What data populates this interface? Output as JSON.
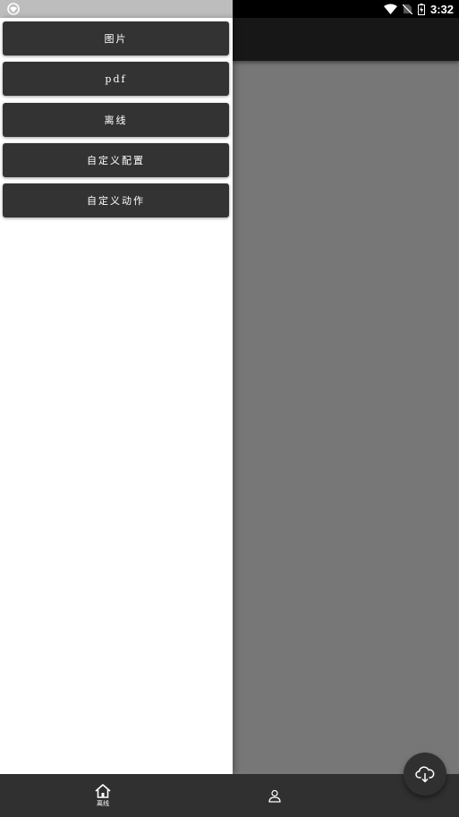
{
  "status_bar": {
    "time": "3:32",
    "icons": [
      "app-notification-icon",
      "wifi-icon",
      "no-sim-icon",
      "battery-charging-icon"
    ]
  },
  "drawer": {
    "items": [
      {
        "label": "图片"
      },
      {
        "label": "pdf"
      },
      {
        "label": "离线"
      },
      {
        "label": "自定义配置"
      },
      {
        "label": "自定义动作"
      }
    ]
  },
  "bottom_nav": {
    "items": [
      {
        "label": "离线",
        "icon": "home-icon"
      },
      {
        "label": "",
        "icon": "person-icon"
      }
    ]
  },
  "fab": {
    "icon": "cloud-download-icon"
  },
  "colors": {
    "drawer_bg": "#ffffff",
    "button_bg": "#333333",
    "scrim": "#777777",
    "toolbar": "#171717",
    "bottom_nav": "#303030"
  }
}
